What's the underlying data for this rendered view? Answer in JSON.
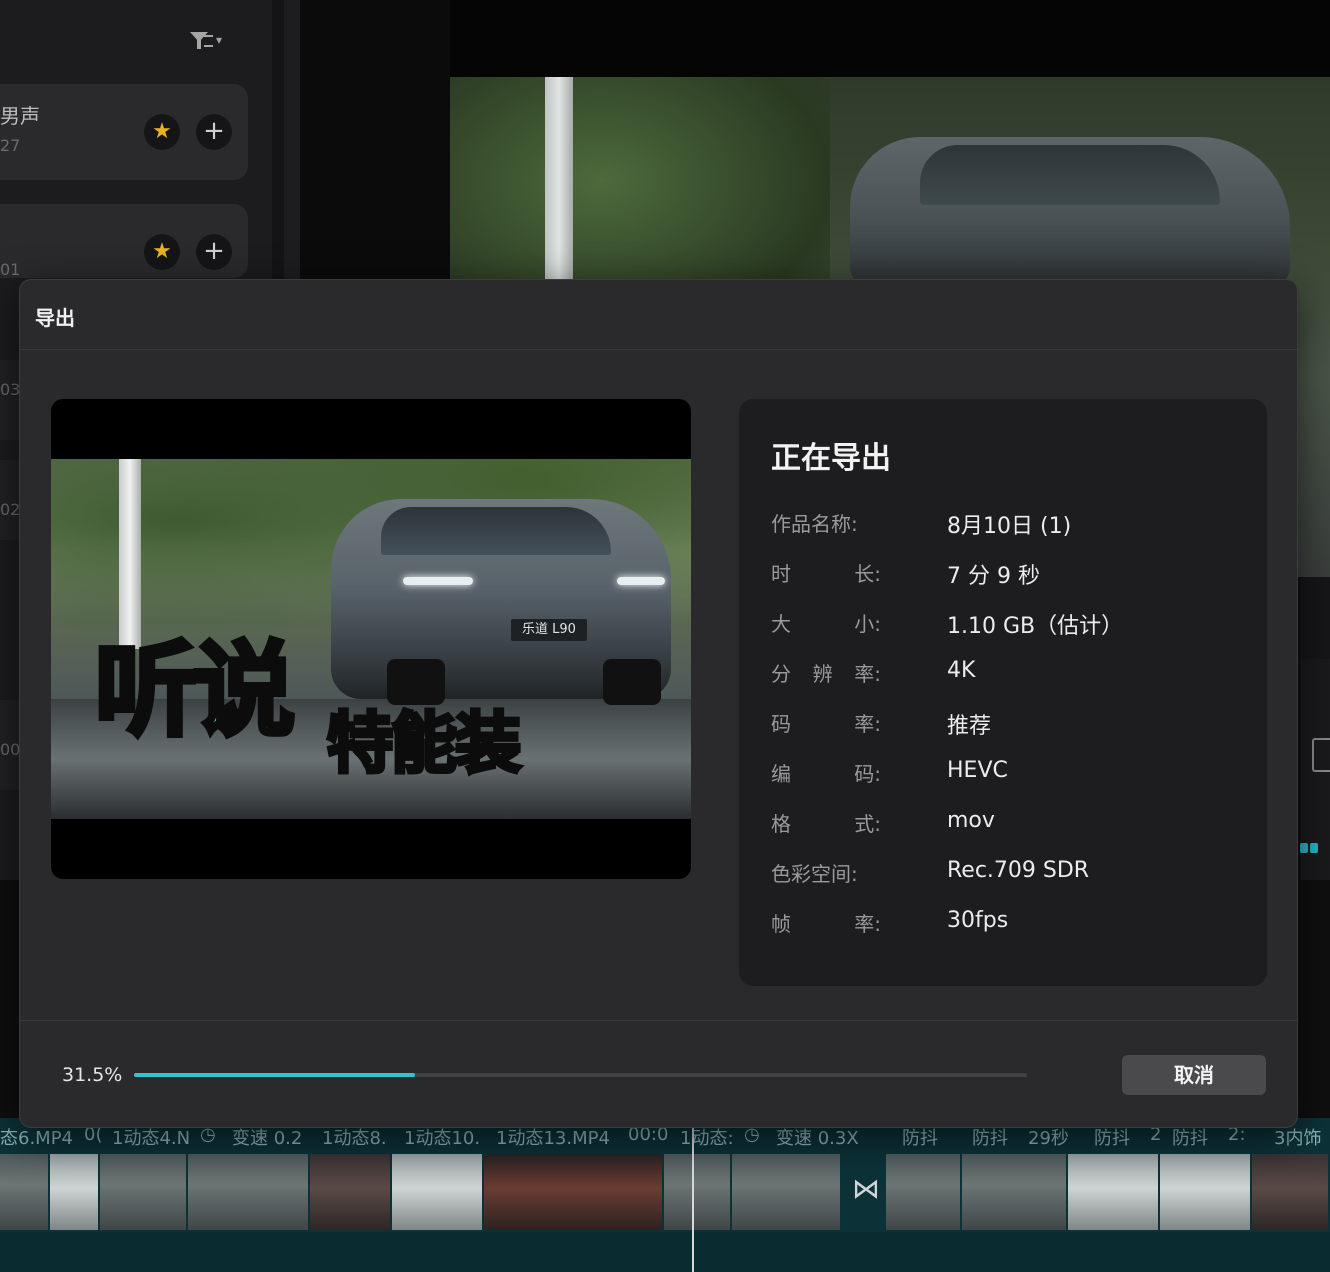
{
  "background": {
    "voice_cards": [
      {
        "title": "男声",
        "sub": "27"
      },
      {
        "title": "",
        "sub": "01"
      }
    ],
    "edge_numbers": [
      "03",
      "02",
      "00"
    ]
  },
  "timeline": {
    "clips": [
      "态6.MP4",
      "0(",
      "1动态4.N",
      "变速 0.2",
      "1动态8.",
      "1动态10.",
      "1动态13.MP4",
      "00:0",
      "1动态:",
      "变速 0.3X",
      "防抖",
      "防抖",
      "29秒",
      "防抖",
      "2",
      "防抖",
      "2:",
      "3内饰"
    ]
  },
  "dialog": {
    "title": "导出",
    "preview": {
      "plate": "乐道 L90",
      "overlay_line1": "听说",
      "overlay_line2": "特能装"
    },
    "info": {
      "heading": "正在导出",
      "rows": [
        {
          "label": [
            "作品名称:"
          ],
          "value": "8月10日 (1)"
        },
        {
          "label": [
            "时",
            "长:"
          ],
          "value": "7 分 9 秒"
        },
        {
          "label": [
            "大",
            "小:"
          ],
          "value": "1.10 GB（估计）"
        },
        {
          "label": [
            "分",
            "辨",
            "率:"
          ],
          "value": "4K"
        },
        {
          "label": [
            "码",
            "率:"
          ],
          "value": "推荐"
        },
        {
          "label": [
            "编",
            "码:"
          ],
          "value": "HEVC"
        },
        {
          "label": [
            "格",
            "式:"
          ],
          "value": "mov"
        },
        {
          "label": [
            "色彩空间:"
          ],
          "value": "Rec.709 SDR"
        },
        {
          "label": [
            "帧",
            "率:"
          ],
          "value": "30fps"
        }
      ]
    },
    "progress": {
      "text": "31.5%",
      "fraction": 0.315
    },
    "cancel_label": "取消"
  },
  "colors": {
    "accent": "#33c3d3",
    "star": "#e7b321",
    "overlay_cyan": "#58dde6",
    "overlay_yellow": "#f4d61c"
  }
}
